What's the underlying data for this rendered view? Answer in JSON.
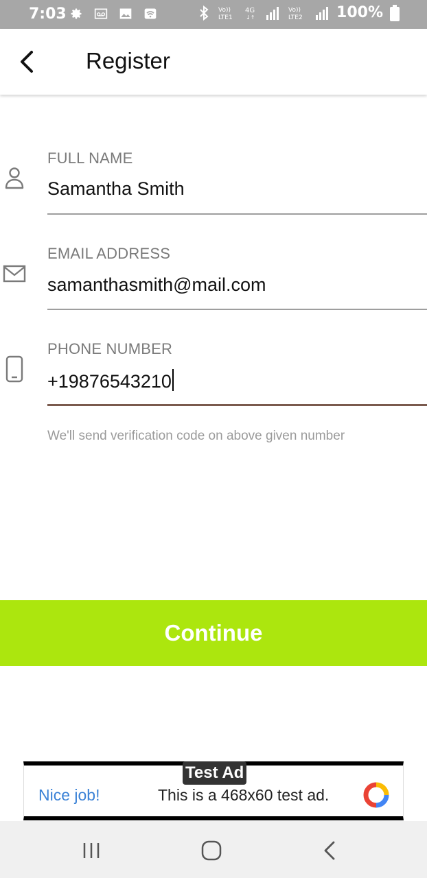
{
  "status_bar": {
    "time": "7:03",
    "battery": "100%",
    "icons": [
      "gear-icon",
      "voicemail-icon",
      "image-icon",
      "wifi-icon",
      "bluetooth-icon",
      "volte-lte1-icon",
      "4g-icon",
      "signal-icon",
      "volte-lte2-icon",
      "signal-icon",
      "battery-icon"
    ]
  },
  "app_bar": {
    "title": "Register",
    "back_icon": "chevron-left-icon"
  },
  "form": {
    "full_name": {
      "label": "FULL NAME",
      "value": "Samantha Smith",
      "icon": "person-icon"
    },
    "email": {
      "label": "EMAIL ADDRESS",
      "value": "samanthasmith@mail.com",
      "icon": "mail-icon"
    },
    "phone": {
      "label": "PHONE NUMBER",
      "value": "+19876543210",
      "icon": "phone-icon"
    },
    "helper": "We'll send verification code on above given number"
  },
  "continue_label": "Continue",
  "ad": {
    "badge": "Test Ad",
    "nice": "Nice job!",
    "text": "This is a 468x60 test ad."
  },
  "colors": {
    "accent": "#ace60e",
    "active_underline": "#7a5a4e",
    "status_bar": "#a7a7a7"
  }
}
